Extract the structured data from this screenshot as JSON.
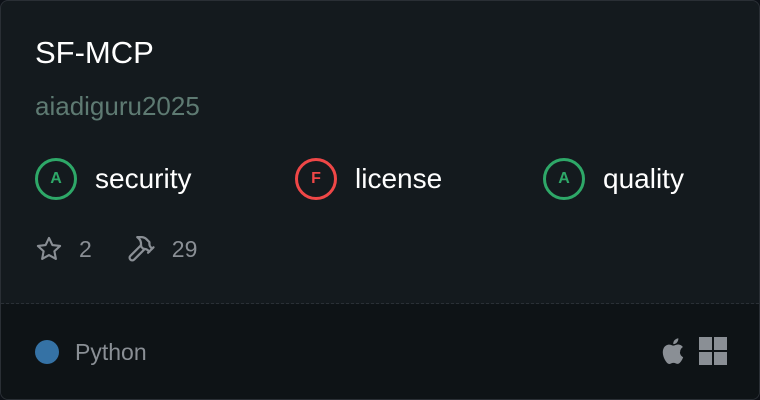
{
  "server": {
    "name": "SF-MCP",
    "author": "aiadiguru2025"
  },
  "scores": [
    {
      "grade": "A",
      "label": "security",
      "color": "#2ea868"
    },
    {
      "grade": "F",
      "label": "license",
      "color": "#ef4747"
    },
    {
      "grade": "A",
      "label": "quality",
      "color": "#2ea868"
    }
  ],
  "stats": {
    "stars": "2",
    "tools": "29",
    "stars_icon": "star-icon",
    "tools_icon": "hammer-icon"
  },
  "footer": {
    "language": "Python",
    "language_color": "#3572a5",
    "platforms": [
      "apple-icon",
      "windows-icon"
    ]
  }
}
